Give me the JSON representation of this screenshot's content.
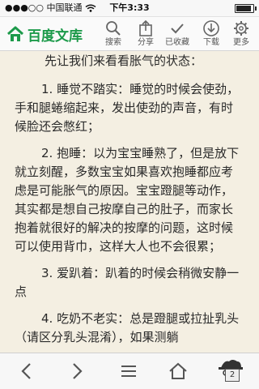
{
  "status_bar": {
    "signal": "●●●○○",
    "carrier": "中国联通",
    "time": "下午3:33"
  },
  "header": {
    "app_name": "百度文库",
    "actions": {
      "search": "搜索",
      "share": "分享",
      "favorited": "已收藏",
      "download": "下载",
      "more": "更多"
    }
  },
  "document": {
    "paragraphs": [
      "先让我们来看看胀气的状态：",
      "1. 睡觉不踏实：睡觉的时候会使劲，手和腿蜷缩起来，发出使劲的声音，有时候脸还会憋红；",
      "2. 抱睡：以为宝宝睡熟了，但是放下就立刻醒，多数宝宝如果喜欢抱睡都应考虑是可能胀气的原因。宝宝蹬腿等动作，其实都是想自己按摩自己的肚子，而家长抱着就很好的解决的按摩的问题，这时候可以使用背巾，这样大人也不会很累；",
      "3. 爱趴着：趴着的时候会稍微安静一点",
      "4. 吃奶不老实：总是蹬腿或拉扯乳头（请区分乳头混淆），如果测躺"
    ]
  },
  "bottom_bar": {
    "tab_count": "2",
    "icons": [
      "back-icon",
      "forward-icon",
      "menu-icon",
      "home-icon",
      "incognito-tabs-icon"
    ]
  },
  "colors": {
    "background": "#f4efe2",
    "brand_green": "#1c9a4a"
  }
}
